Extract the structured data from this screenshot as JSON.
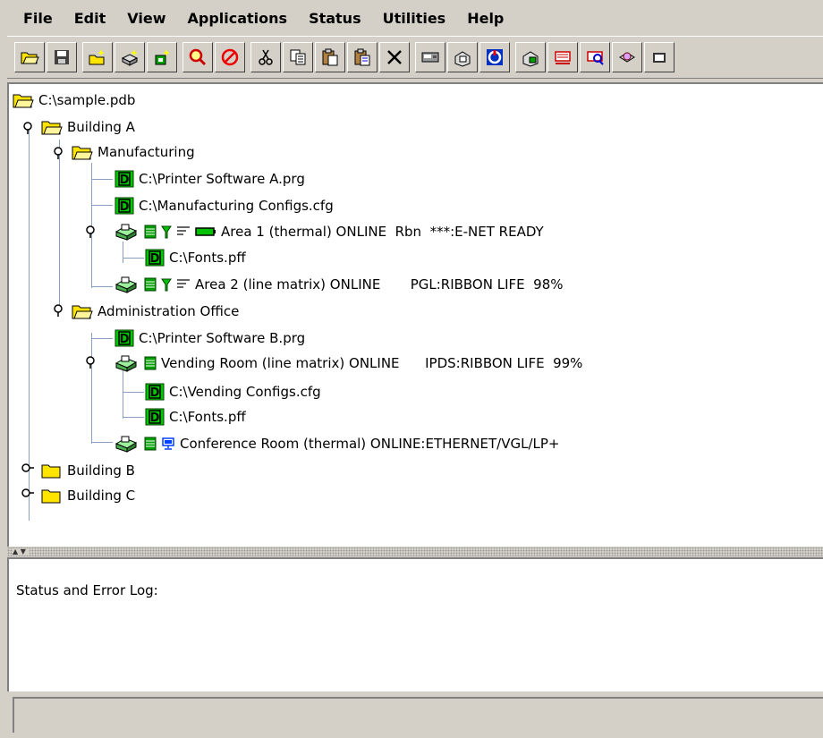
{
  "menu": [
    "File",
    "Edit",
    "View",
    "Applications",
    "Status",
    "Utilities",
    "Help"
  ],
  "toolbar_icons": [
    "open-folder-icon",
    "save-icon",
    "new-folder-icon",
    "new-printer-icon",
    "new-device-icon",
    "find-icon",
    "stop-icon",
    "cut-icon",
    "copy-icon",
    "paste-icon",
    "paste-special-icon",
    "delete-icon",
    "printer-panel-icon",
    "printer-properties-icon",
    "printer-reset-icon",
    "printer-status-icon",
    "printer-config-icon",
    "printer-query-icon",
    "printer-settings-icon",
    "more-icon"
  ],
  "tree": {
    "root": "C:\\sample.pdb",
    "building_a": "Building A",
    "manufacturing": "Manufacturing",
    "printer_sw_a": "C:\\Printer Software A.prg",
    "mfg_configs": "C:\\Manufacturing Configs.cfg",
    "area1": "Area 1 (thermal) ONLINE  Rbn  ***:E-NET READY",
    "area1_fonts": "C:\\Fonts.pff",
    "area2": "Area 2 (line matrix) ONLINE       PGL:RIBBON LIFE  98%",
    "admin_office": "Administration Office",
    "printer_sw_b": "C:\\Printer Software B.prg",
    "vending": "Vending Room (line matrix) ONLINE      IPDS:RIBBON LIFE  99%",
    "vending_configs": "C:\\Vending Configs.cfg",
    "vending_fonts": "C:\\Fonts.pff",
    "conference": "Conference Room (thermal) ONLINE:ETHERNET/VGL/LP+",
    "building_b": "Building B",
    "building_c": "Building C"
  },
  "log": {
    "label": "Status and Error Log:"
  },
  "colors": {
    "folder": "#ffe400",
    "doc_green": "#00c800",
    "tree_line": "#8aa0c0"
  }
}
